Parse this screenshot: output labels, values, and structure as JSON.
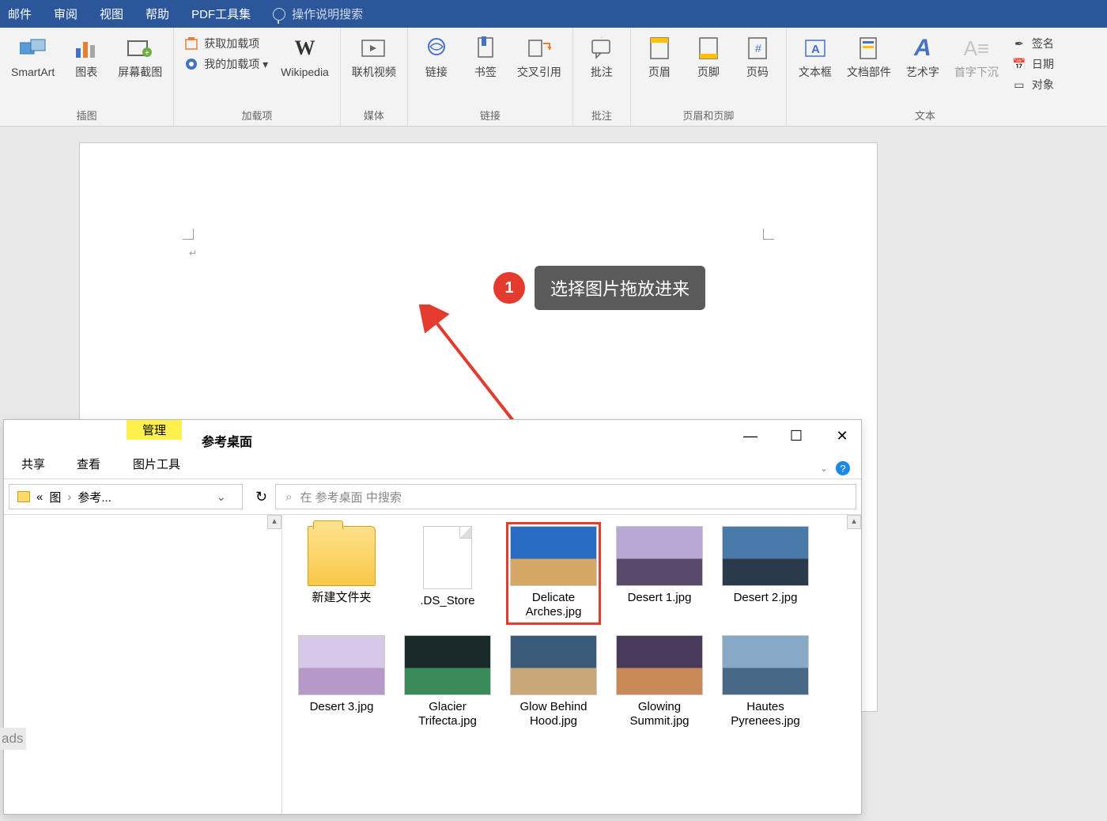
{
  "menubar": {
    "items": [
      "邮件",
      "审阅",
      "视图",
      "帮助",
      "PDF工具集"
    ],
    "search_hint": "操作说明搜索"
  },
  "ribbon": {
    "groups": [
      {
        "label": "插图",
        "buttons": [
          {
            "label": "SmartArt",
            "icon": "smartart"
          },
          {
            "label": "图表",
            "icon": "chart"
          },
          {
            "label": "屏幕截图",
            "icon": "screenshot"
          }
        ]
      },
      {
        "label": "加载项",
        "rows": [
          {
            "label": "获取加载项",
            "icon": "store"
          },
          {
            "label": "我的加载项 ▾",
            "icon": "myaddins"
          }
        ],
        "buttons": [
          {
            "label": "Wikipedia",
            "icon": "wikipedia"
          }
        ]
      },
      {
        "label": "媒体",
        "buttons": [
          {
            "label": "联机视频",
            "icon": "video"
          }
        ]
      },
      {
        "label": "链接",
        "buttons": [
          {
            "label": "链接",
            "icon": "link"
          },
          {
            "label": "书签",
            "icon": "bookmark"
          },
          {
            "label": "交叉引用",
            "icon": "crossref"
          }
        ]
      },
      {
        "label": "批注",
        "buttons": [
          {
            "label": "批注",
            "icon": "comment"
          }
        ]
      },
      {
        "label": "页眉和页脚",
        "buttons": [
          {
            "label": "页眉",
            "icon": "header"
          },
          {
            "label": "页脚",
            "icon": "footer"
          },
          {
            "label": "页码",
            "icon": "pagenum"
          }
        ]
      },
      {
        "label": "文本",
        "buttons": [
          {
            "label": "文本框",
            "icon": "textbox"
          },
          {
            "label": "文档部件",
            "icon": "parts"
          },
          {
            "label": "艺术字",
            "icon": "wordart"
          },
          {
            "label": "首字下沉",
            "icon": "dropcap"
          }
        ],
        "side": [
          {
            "label": "签名",
            "icon": "signature"
          },
          {
            "label": "日期",
            "icon": "date"
          },
          {
            "label": "对象",
            "icon": "object"
          }
        ]
      }
    ]
  },
  "annotation": {
    "number": "1",
    "text": "选择图片拖放进来"
  },
  "explorer": {
    "contextual": "管理",
    "title": "参考桌面",
    "tabs": [
      "共享",
      "查看"
    ],
    "contextual_sub": "图片工具",
    "breadcrumb": {
      "prefix": "«",
      "parts": [
        "图",
        "参考..."
      ]
    },
    "search_placeholder": "在 参考桌面 中搜索",
    "files": [
      {
        "name": "新建文件夹",
        "type": "folder"
      },
      {
        "name": ".DS_Store",
        "type": "blank"
      },
      {
        "name": "Delicate Arches.jpg",
        "type": "image",
        "selected": true,
        "colors": [
          "#2a6bc4",
          "#d4a864"
        ]
      },
      {
        "name": "Desert 1.jpg",
        "type": "image",
        "colors": [
          "#b8a8d4",
          "#5a4a6a"
        ]
      },
      {
        "name": "Desert 2.jpg",
        "type": "image",
        "colors": [
          "#4a7aa8",
          "#2a3a4a"
        ]
      },
      {
        "name": "Desert 3.jpg",
        "type": "image",
        "colors": [
          "#d8c8e8",
          "#b898c8"
        ]
      },
      {
        "name": "Glacier Trifecta.jpg",
        "type": "image",
        "colors": [
          "#1a2a2a",
          "#3a8a5a"
        ]
      },
      {
        "name": "Glow Behind Hood.jpg",
        "type": "image",
        "colors": [
          "#3a5a7a",
          "#c8a878"
        ]
      },
      {
        "name": "Glowing Summit.jpg",
        "type": "image",
        "colors": [
          "#4a3a5a",
          "#c88858"
        ]
      },
      {
        "name": "Hautes Pyrenees.jpg",
        "type": "image",
        "colors": [
          "#88a8c8",
          "#486888"
        ]
      }
    ]
  },
  "ads_text": "ads"
}
